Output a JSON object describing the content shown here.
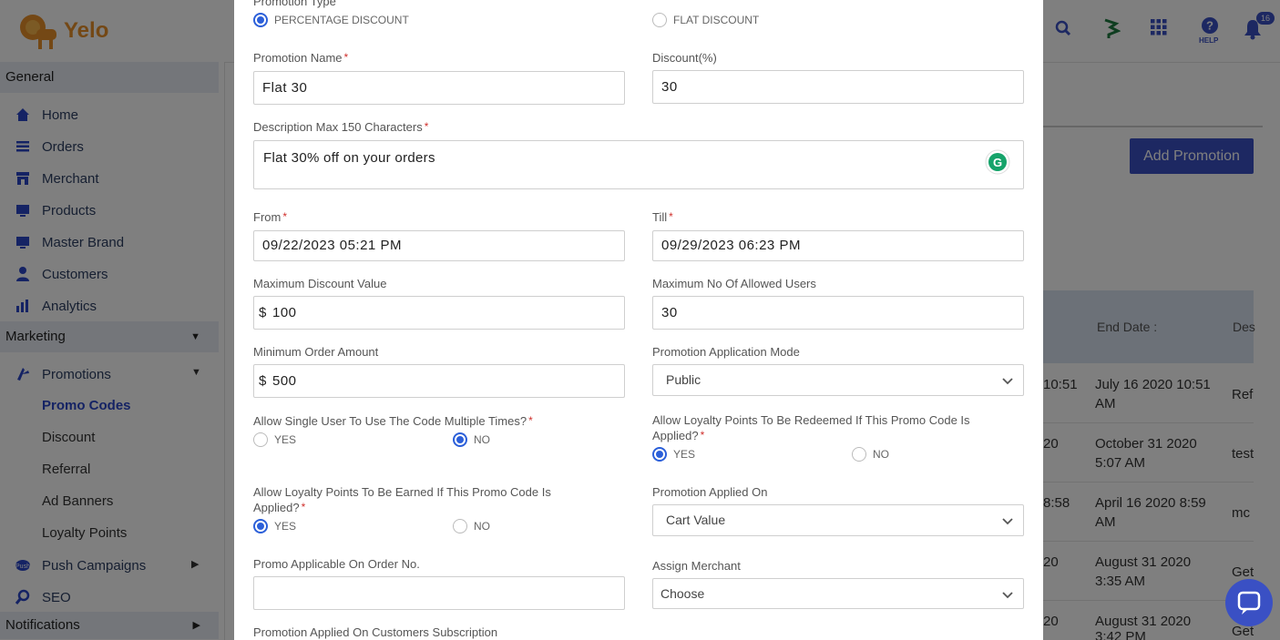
{
  "brand": {
    "name": "Yelo"
  },
  "header": {
    "help_label": "HELP",
    "notification_count": "16"
  },
  "sidebar": {
    "general": "General",
    "items": [
      {
        "label": "Home",
        "icon": "home-icon"
      },
      {
        "label": "Orders",
        "icon": "orders-icon"
      },
      {
        "label": "Merchant",
        "icon": "merchant-icon"
      },
      {
        "label": "Products",
        "icon": "products-icon"
      },
      {
        "label": "Master Brand",
        "icon": "master-brand-icon"
      },
      {
        "label": "Customers",
        "icon": "customers-icon"
      },
      {
        "label": "Analytics",
        "icon": "analytics-icon"
      }
    ],
    "marketing": "Marketing",
    "promotions": "Promotions",
    "sub_items": [
      "Promo Codes",
      "Discount",
      "Referral",
      "Ad Banners",
      "Loyalty Points"
    ],
    "push_campaigns": "Push Campaigns",
    "seo": "SEO",
    "notifications": "Notifications"
  },
  "background": {
    "add_promotion": "Add Promotion",
    "table_headers": [
      "End Date :",
      "Des"
    ],
    "rows": [
      {
        "start_tail": "10:51",
        "end_line1": "July 16 2020 10:51",
        "end_line2": "AM",
        "desc": "Ref"
      },
      {
        "start_tail": "20",
        "end_line1": "October 31 2020",
        "end_line2": "5:07 AM",
        "desc": "test"
      },
      {
        "start_tail": "8:58",
        "end_line1": "April 16 2020 8:59",
        "end_line2": "AM",
        "desc": "mc"
      },
      {
        "start_tail": "20",
        "end_line1": "August 31 2020",
        "end_line2": "3:35 AM",
        "desc": "Get"
      },
      {
        "start_tail": "20",
        "end_line1": "August 31 2020",
        "end_line2": "3:42 PM",
        "desc": "Get"
      }
    ]
  },
  "modal": {
    "promotion_type_label": "Promotion Type",
    "type_percentage": "PERCENTAGE DISCOUNT",
    "type_flat": "FLAT DISCOUNT",
    "promotion_name_label": "Promotion Name",
    "promotion_name_value": "Flat 30",
    "discount_label": "Discount(%)",
    "discount_value": "30",
    "description_label": "Description Max 150 Characters",
    "description_value": "Flat 30% off on your orders",
    "from_label": "From",
    "from_value": "09/22/2023 05:21 PM",
    "till_label": "Till",
    "till_value": "09/29/2023 06:23 PM",
    "max_discount_label": "Maximum Discount Value",
    "max_discount_value": "100",
    "max_users_label": "Maximum No Of Allowed Users",
    "max_users_value": "30",
    "min_order_label": "Minimum Order Amount",
    "min_order_value": "500",
    "currency": "$",
    "application_mode_label": "Promotion Application Mode",
    "application_mode_value": "Public",
    "single_user_label": "Allow Single User To Use The Code Multiple Times?",
    "loyalty_redeem_label": "Allow Loyalty Points To Be Redeemed If This Promo Code Is Applied?",
    "loyalty_earn_label": "Allow Loyalty Points To Be Earned If This Promo Code Is Applied?",
    "yes": "YES",
    "no": "NO",
    "applied_on_label": "Promotion Applied On",
    "applied_on_value": "Cart Value",
    "order_no_label": "Promo Applicable On Order No.",
    "order_no_value": "",
    "assign_merchant_label": "Assign Merchant",
    "assign_merchant_value": "Choose",
    "subscription_label": "Promotion Applied On Customers Subscription"
  },
  "colors": {
    "primary": "#3a50c4",
    "radio": "#2b5fd9",
    "required": "#d0302c",
    "logo": "#e8902a"
  }
}
